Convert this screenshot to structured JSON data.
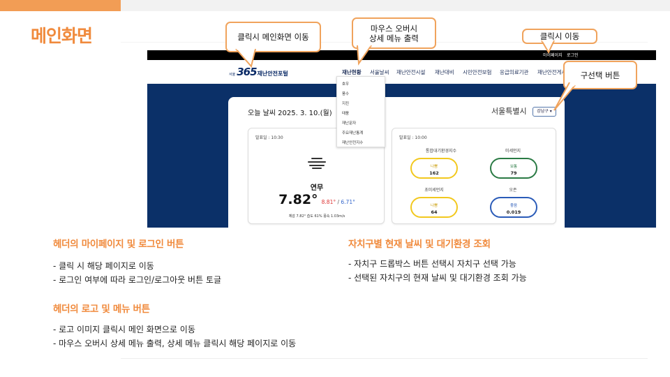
{
  "slide": {
    "title": "메인화면"
  },
  "mockup": {
    "topbar": {
      "mypage": "마이페이지",
      "login": "로그인"
    },
    "logo": {
      "small": "서울",
      "number": "365",
      "text": "재난안전포털"
    },
    "nav": [
      "재난현황",
      "서울날씨",
      "재난안전시설",
      "재난대비",
      "시민안전보험",
      "응급의료기관",
      "재난안전게시판"
    ],
    "dropdown": [
      "호우",
      "풍수",
      "지진",
      "태풍",
      "재난문자",
      "주요재난통계",
      "재난안전지수"
    ],
    "weather": {
      "today": "오늘 날씨 2025. 3. 10.(월)",
      "city": "서울특별시",
      "district": "강남구 ▾",
      "left_card": {
        "published": "발표일 : 10:30",
        "condition": "연무",
        "temp": "7.82°",
        "high": "8.81°",
        "sep": " / ",
        "low": "6.71°",
        "detail": "체감 7.82°  습도 61%  풍속 1.03m/s"
      },
      "right_card": {
        "published": "발표일 : 10:00",
        "items": [
          {
            "label": "통합대기환경지수",
            "status": "나쁨",
            "value": "162"
          },
          {
            "label": "미세먼지",
            "status": "보통",
            "value": "79"
          },
          {
            "label": "초미세먼지",
            "status": "나쁨",
            "value": "64"
          },
          {
            "label": "오존",
            "status": "좋음",
            "value": "0.019"
          }
        ]
      }
    }
  },
  "callouts": {
    "main_move": "클릭시 메인화면 이동",
    "hover_line1": "마우스 오버시",
    "hover_line2": "상세 메뉴 출력",
    "click_move": "클릭시 이동",
    "district_button": "구선택 버튼"
  },
  "sections": [
    {
      "title": "헤더의 마이페이지 및 로그인 버튼",
      "bullets": [
        "- 클릭 시 해당 페이지로 이동",
        "- 로그인 여부에 따라 로그인/로그아웃 버튼 토글"
      ]
    },
    {
      "title": "헤더의 로고 및 메뉴 버튼",
      "bullets": [
        "- 로고 이미지 클릭시 메인 화면으로 이동",
        "- 마우스 오버시 상세 메뉴 출력, 상세 메뉴 클릭시 해당 페이지로 이동"
      ]
    },
    {
      "title": "자치구별 현재 날씨 및 대기환경 조회",
      "bullets": [
        "- 자치구 드롭박스 버튼 선택시 자치구 선택 가능",
        "- 선택된 자치구의 현재 날씨 및 대기환경 조회 가능"
      ]
    }
  ],
  "colors": {
    "accent": "#f08a3c",
    "navy": "#0b3068",
    "callout_border": "#f0a35c"
  }
}
